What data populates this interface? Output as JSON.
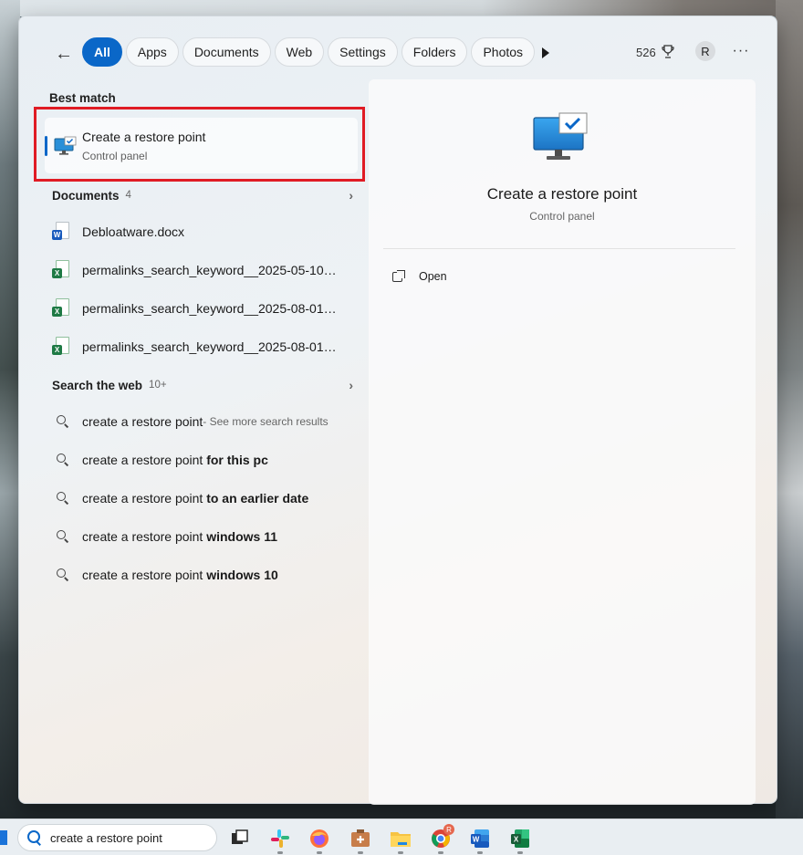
{
  "header": {
    "tabs": [
      {
        "label": "All",
        "active": true
      },
      {
        "label": "Apps"
      },
      {
        "label": "Documents"
      },
      {
        "label": "Web"
      },
      {
        "label": "Settings"
      },
      {
        "label": "Folders"
      },
      {
        "label": "Photos"
      }
    ],
    "points": "526",
    "avatar_initial": "R",
    "more_label": "···"
  },
  "best_match": {
    "section_label": "Best match",
    "title": "Create a restore point",
    "subtitle": "Control panel"
  },
  "documents": {
    "section_label": "Documents",
    "count": "4",
    "items": [
      {
        "label": "Debloatware.docx",
        "type": "word"
      },
      {
        "label": "permalinks_search_keyword__2025-05-10_2...",
        "type": "excel"
      },
      {
        "label": "permalinks_search_keyword__2025-08-01_2...",
        "type": "excel"
      },
      {
        "label": "permalinks_search_keyword__2025-08-01_2...",
        "type": "excel"
      }
    ]
  },
  "web": {
    "section_label": "Search the web",
    "count": "10+",
    "items": [
      {
        "query": "create a restore point",
        "bold": "",
        "suffix": " - See more search results"
      },
      {
        "query": "create a restore point ",
        "bold": "for this pc",
        "suffix": ""
      },
      {
        "query": "create a restore point ",
        "bold": "to an earlier date",
        "suffix": ""
      },
      {
        "query": "create a restore point ",
        "bold": "windows 11",
        "suffix": ""
      },
      {
        "query": "create a restore point ",
        "bold": "windows 10",
        "suffix": ""
      }
    ]
  },
  "preview": {
    "title": "Create a restore point",
    "subtitle": "Control panel",
    "actions": [
      {
        "label": "Open"
      }
    ]
  },
  "taskbar": {
    "search_text": "create a restore point",
    "apps": [
      "task-view",
      "slack",
      "firefox",
      "app",
      "file-explorer",
      "chrome",
      "word",
      "excel"
    ],
    "chrome_badge": "R"
  },
  "colors": {
    "accent": "#0a67c8",
    "highlight_box": "#e01b24"
  }
}
